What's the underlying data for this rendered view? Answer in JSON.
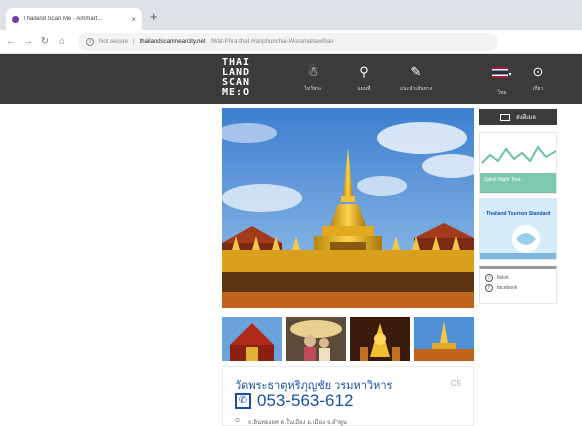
{
  "browser": {
    "tab_title": "Thailand Scan Me - Ammart...",
    "tab_close": "×",
    "new_tab": "+",
    "nav": {
      "back": "←",
      "forward": "→",
      "reload": "↻",
      "home": "⌂"
    },
    "url_prefix": "Not secure",
    "url_domain": "thailandscanmearcity.net",
    "url_path": "/Wat-Phra-that-Hariphunchai-Woramahawihan"
  },
  "site": {
    "logo_lines": [
      "THAI",
      "LAND",
      "SCAN",
      "ME:O"
    ],
    "nav_items": [
      {
        "glyph": "☃",
        "label": "ไหว้พระ"
      },
      {
        "glyph": "⚲",
        "label": "แผนที่"
      },
      {
        "glyph": "✎",
        "label": "แนะนำเส้นทาง"
      }
    ],
    "lang_label": "ไทย",
    "about_glyph": "⊙",
    "about_label": "เกี่ยว"
  },
  "sidebar": {
    "share_label": "ส่งอีเมล",
    "ad1_caption": "Sakol Night Tour...",
    "ad2_caption": "Thailand Tourism Standard",
    "social": [
      {
        "icon": "♫",
        "label": "tiktok"
      },
      {
        "icon": "f",
        "label": "facebook"
      }
    ]
  },
  "place": {
    "name": "วัดพระธาตุหริภุญชัย วรมหาวิหาร",
    "tag": "C5",
    "phone": "053-563-612",
    "address_icon": "⊙",
    "address": "ถ.อินทยงยศ ต.ในเมือง อ.เมือง จ.ลำพูน"
  },
  "colors": {
    "header_bg": "#3b3b3b",
    "link_blue": "#1a4fa8",
    "gold": "#d4a017"
  }
}
